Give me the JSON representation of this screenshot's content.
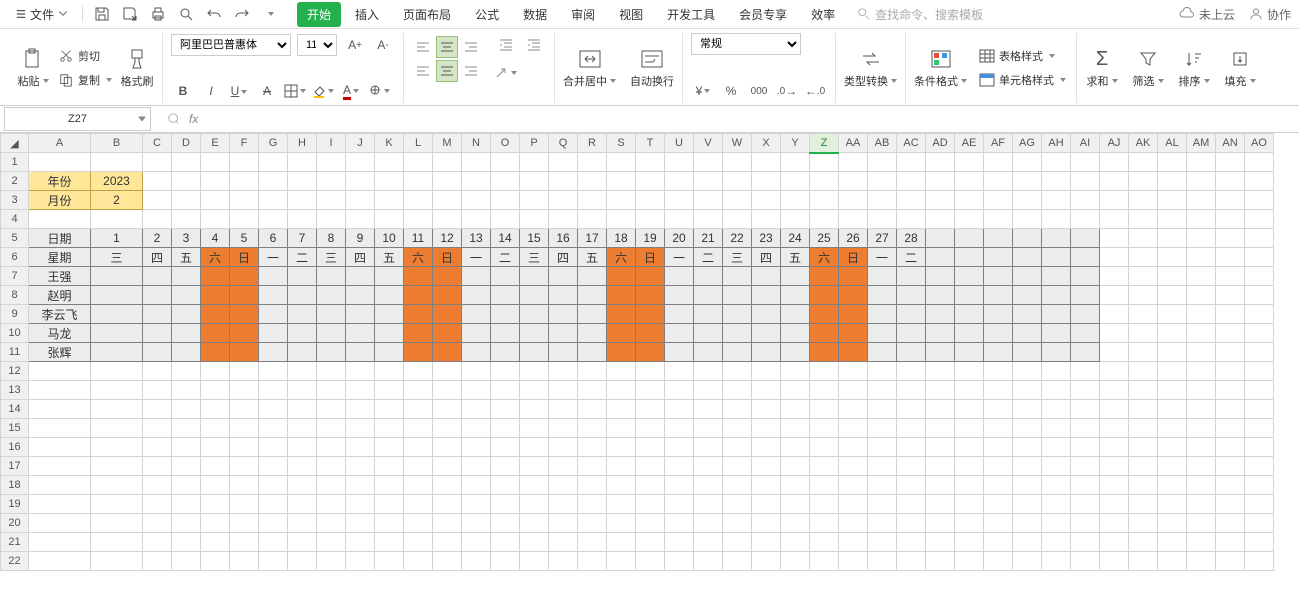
{
  "menubar": {
    "file": "文件",
    "tabs": [
      "开始",
      "插入",
      "页面布局",
      "公式",
      "数据",
      "审阅",
      "视图",
      "开发工具",
      "会员专享",
      "效率"
    ],
    "search_placeholder": "查找命令、搜索模板",
    "cloud": "未上云",
    "coop": "协作"
  },
  "ribbon": {
    "paste": "粘贴",
    "cut": "剪切",
    "copy": "复制",
    "format_painter": "格式刷",
    "font_name": "阿里巴巴普惠体",
    "font_size": "11",
    "merge": "合并居中",
    "wrap": "自动换行",
    "num_format": "常规",
    "type_convert": "类型转换",
    "cond_fmt": "条件格式",
    "table_style": "表格样式",
    "cell_style": "单元格样式",
    "sum": "求和",
    "filter": "筛选",
    "sort": "排序",
    "fill": "填充"
  },
  "namebox": "Z27",
  "cols": [
    "A",
    "B",
    "C",
    "D",
    "E",
    "F",
    "G",
    "H",
    "I",
    "J",
    "K",
    "L",
    "M",
    "N",
    "O",
    "P",
    "Q",
    "R",
    "S",
    "T",
    "U",
    "V",
    "W",
    "X",
    "Y",
    "Z",
    "AA",
    "AB",
    "AC",
    "AD",
    "AE",
    "AF",
    "AG",
    "AH",
    "AI",
    "AJ",
    "AK",
    "AL",
    "AM",
    "AN",
    "AO"
  ],
  "selected_col": "Z",
  "wide_cols": [
    "A"
  ],
  "med_cols": [
    "B"
  ],
  "rows": 22,
  "data": {
    "year_label": "年份",
    "year_val": "2023",
    "month_label": "月份",
    "month_val": "2",
    "date_label": "日期",
    "week_label": "星期",
    "dates": [
      "1",
      "2",
      "3",
      "4",
      "5",
      "6",
      "7",
      "8",
      "9",
      "10",
      "11",
      "12",
      "13",
      "14",
      "15",
      "16",
      "17",
      "18",
      "19",
      "20",
      "21",
      "22",
      "23",
      "24",
      "25",
      "26",
      "27",
      "28"
    ],
    "weekdays": [
      "三",
      "四",
      "五",
      "六",
      "日",
      "一",
      "二",
      "三",
      "四",
      "五",
      "六",
      "日",
      "一",
      "二",
      "三",
      "四",
      "五",
      "六",
      "日",
      "一",
      "二",
      "三",
      "四",
      "五",
      "六",
      "日",
      "一",
      "二"
    ],
    "weekend_idx": [
      3,
      4,
      10,
      11,
      17,
      18,
      24,
      25
    ],
    "names": [
      "王强",
      "赵明",
      "李云飞",
      "马龙",
      "张辉"
    ]
  }
}
